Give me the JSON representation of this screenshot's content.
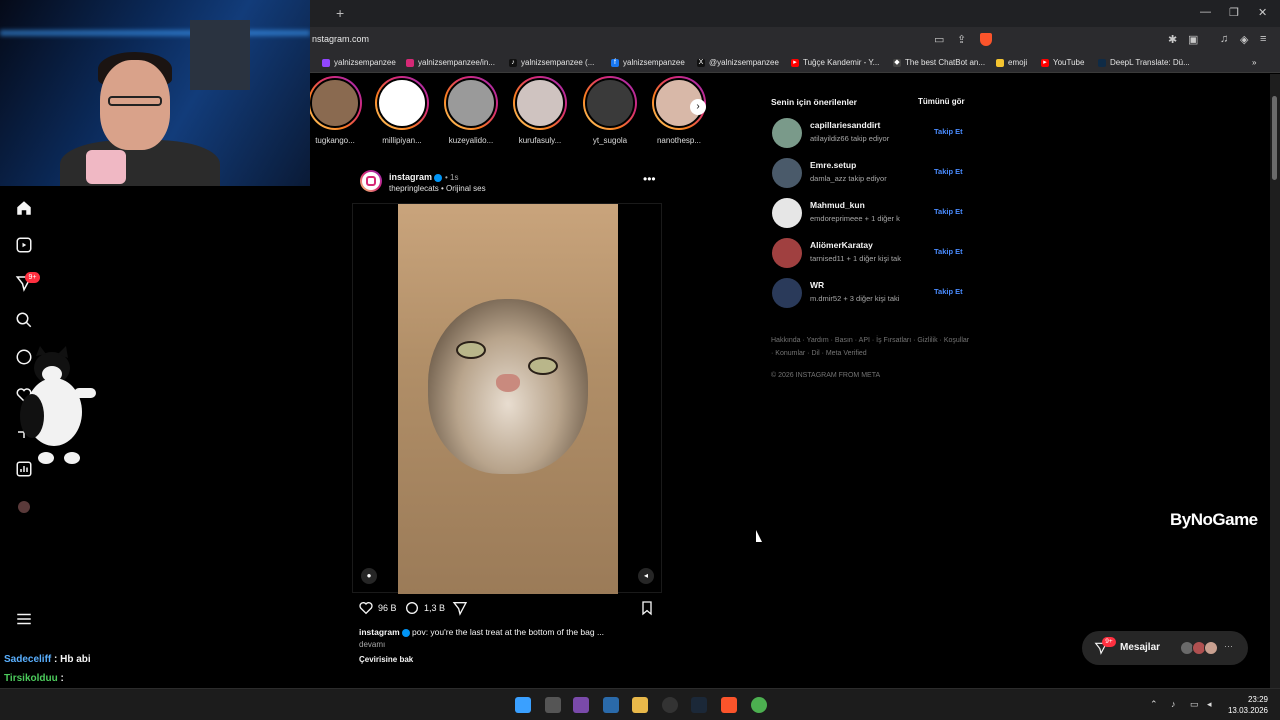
{
  "browser": {
    "url": "nstagram.com",
    "new_tab": "+",
    "bookmarks": [
      {
        "label": "yalnizsempanzee",
        "color": "#9146ff"
      },
      {
        "label": "yalnizsempanzee/in...",
        "color": "#d62976"
      },
      {
        "label": "yalnizsempanzee (...",
        "color": "#000000"
      },
      {
        "label": "yalnizsempanzee",
        "color": "#1877f2"
      },
      {
        "label": "@yalnizsempanzee",
        "color": "#000000"
      },
      {
        "label": "Tuğçe Kandemir - Y...",
        "color": "#ff0000"
      },
      {
        "label": "The best ChatBot an...",
        "color": "#444444"
      },
      {
        "label": "emoji",
        "color": "#f4c430"
      },
      {
        "label": "YouTube",
        "color": "#ff0000"
      },
      {
        "label": "DeepL Translate: Dü...",
        "color": "#0f2b46"
      }
    ]
  },
  "stories": [
    {
      "name": "tugkango...",
      "color": "#8a6a50"
    },
    {
      "name": "millipiyan...",
      "color": "#ffffff"
    },
    {
      "name": "kuzeyalido...",
      "color": "#9a9a9a"
    },
    {
      "name": "kurufasuly...",
      "color": "#cfc3c0"
    },
    {
      "name": "yt_sugola",
      "color": "#3a3a3a"
    },
    {
      "name": "nanothesp...",
      "color": "#d8b8a8"
    }
  ],
  "post": {
    "username": "instagram",
    "time": "• 1s",
    "subline": "thepringlecats • Orijinal ses",
    "likes": "96 B",
    "comments": "1,3 B",
    "caption_user": "instagram",
    "caption_text": "pov: you're the last treat at the bottom of the bag ...",
    "more": "devamı",
    "translate": "Çevirisine bak"
  },
  "suggestions": {
    "title": "Senin için önerilenler",
    "see_all": "Tümünü gör",
    "follow_label": "Takip Et",
    "items": [
      {
        "name": "capillariesanddirt",
        "sub": "atilayildiz66 takip ediyor",
        "color": "#7a9a8a"
      },
      {
        "name": "Emre.setup",
        "sub": "damla_azz takip ediyor",
        "color": "#4a5a6a"
      },
      {
        "name": "Mahmud_kun",
        "sub": "emdoreprimeee + 1 diğer k",
        "color": "#e6e6e6"
      },
      {
        "name": "AliömerKaratay",
        "sub": "tarnised11 + 1 diğer kişi tak",
        "color": "#a04040"
      },
      {
        "name": "WR",
        "sub": "m.dmir52 + 3 diğer kişi taki",
        "color": "#2a3a5a"
      }
    ]
  },
  "footer": {
    "links": "Hakkında · Yardım · Basın · API · İş Fırsatları · Gizlilik · Koşullar · Konumlar · Dil · Meta Verified",
    "copyright": "© 2026 INSTAGRAM FROM META"
  },
  "nav": {
    "notifications_badge": "9+"
  },
  "messages": {
    "label": "Mesajlar",
    "badge": "9+"
  },
  "watermark": "ByNoGame",
  "chat": [
    {
      "user": "Sadeceliff",
      "text": ": Hb abi"
    },
    {
      "user": "Tirsikolduu",
      "text": ":"
    }
  ],
  "taskbar": {
    "time": "23:29",
    "date": "13.03.2026"
  }
}
